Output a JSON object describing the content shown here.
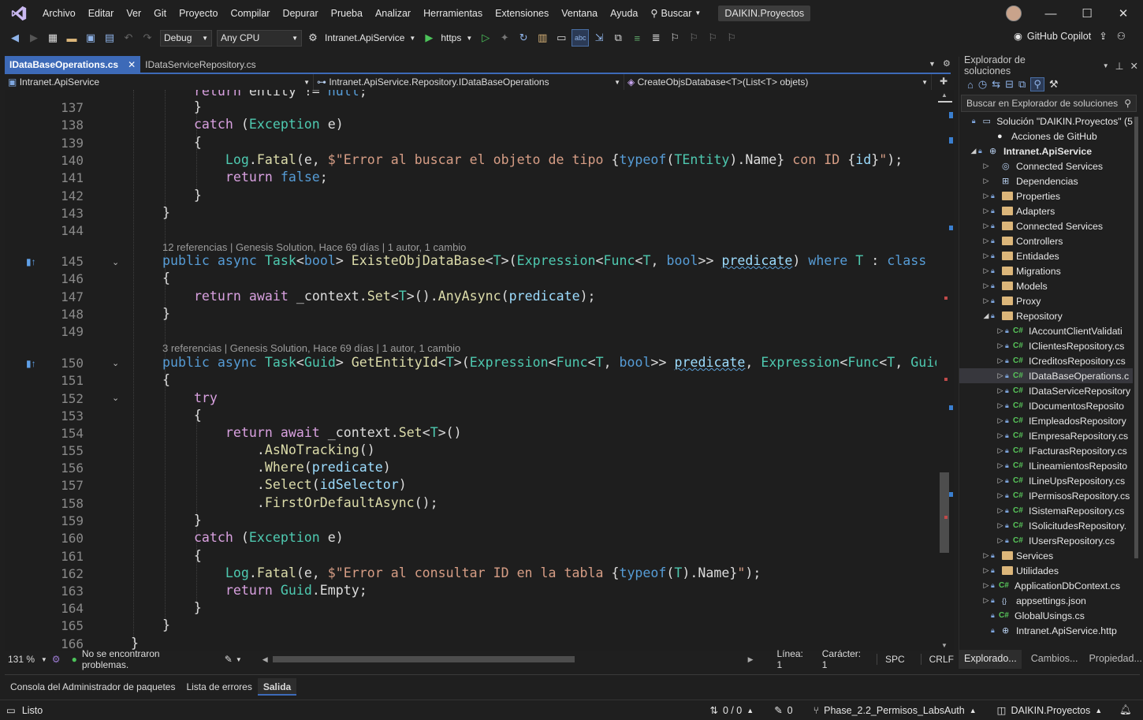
{
  "menu": {
    "items": [
      "Archivo",
      "Editar",
      "Ver",
      "Git",
      "Proyecto",
      "Compilar",
      "Depurar",
      "Prueba",
      "Analizar",
      "Herramientas",
      "Extensiones",
      "Ventana",
      "Ayuda"
    ],
    "search": "Buscar",
    "solution_title": "DAIKIN.Proyectos"
  },
  "toolbar": {
    "config": "Debug",
    "platform": "Any CPU",
    "startup_project": "Intranet.ApiService",
    "launch_profile": "https",
    "copilot": "GitHub Copilot"
  },
  "tabs": [
    {
      "label": "IDataBaseOperations.cs",
      "active": true
    },
    {
      "label": "IDataServiceRepository.cs",
      "active": false
    }
  ],
  "nav": {
    "project": "Intranet.ApiService",
    "type": "Intranet.ApiService.Repository.IDataBaseOperations",
    "member": "CreateObjsDatabase<T>(List<T> objets)"
  },
  "codelens": {
    "l145": "12 referencias | Genesis Solution, Hace 69 días | 1 autor, 1 cambio",
    "l150": "3 referencias | Genesis Solution, Hace 69 días | 1 autor, 1 cambio"
  },
  "line_numbers": [
    "137",
    "138",
    "139",
    "140",
    "141",
    "142",
    "143",
    "144",
    "145",
    "146",
    "147",
    "148",
    "149",
    "150",
    "151",
    "152",
    "153",
    "154",
    "155",
    "156",
    "157",
    "158",
    "159",
    "160",
    "161",
    "162",
    "163",
    "164",
    "165",
    "166"
  ],
  "editor_status": {
    "zoom": "131 %",
    "problems": "No se encontraron problemas.",
    "line": "Línea: 1",
    "char": "Carácter: 1",
    "spc": "SPC",
    "eol": "CRLF"
  },
  "solution_explorer": {
    "title": "Explorador de soluciones",
    "search_placeholder": "Buscar en Explorador de soluciones",
    "solution": "Solución \"DAIKIN.Proyectos\" (5",
    "github_actions": "Acciones de GitHub",
    "project": "Intranet.ApiService",
    "nodes": [
      "Connected Services",
      "Dependencias",
      "Properties",
      "Adapters",
      "Connected Services",
      "Controllers",
      "Entidades",
      "Migrations",
      "Models",
      "Proxy",
      "Repository"
    ],
    "repo_files": [
      "IAccountClientValidati",
      "IClientesRepository.cs",
      "ICreditosRepository.cs",
      "IDataBaseOperations.c",
      "IDataServiceRepository",
      "IDocumentosReposito",
      "IEmpleadosRepository",
      "IEmpresaRepository.cs",
      "IFacturasRepository.cs",
      "ILineamientosReposito",
      "ILineUpsRepository.cs",
      "IPermisosRepository.cs",
      "ISistemaRepository.cs",
      "ISolicitudesRepository.",
      "IUsersRepository.cs"
    ],
    "tail_nodes": [
      "Services",
      "Utilidades",
      "ApplicationDbContext.cs",
      "appsettings.json",
      "GlobalUsings.cs",
      "Intranet.ApiService.http"
    ],
    "tabs": [
      "Explorado...",
      "Cambios...",
      "Propiedad..."
    ]
  },
  "output_tabs": [
    "Consola del Administrador de paquetes",
    "Lista de errores",
    "Salida"
  ],
  "statusbar": {
    "ready": "Listo",
    "sync": "0 / 0",
    "edits": "0",
    "branch": "Phase_2.2_Permisos_LabsAuth",
    "repo": "DAIKIN.Proyectos"
  },
  "colors": {
    "accent": "#3d6ab8",
    "keyword": "#569cd6",
    "type": "#4ec9b0",
    "string": "#d69d85"
  }
}
